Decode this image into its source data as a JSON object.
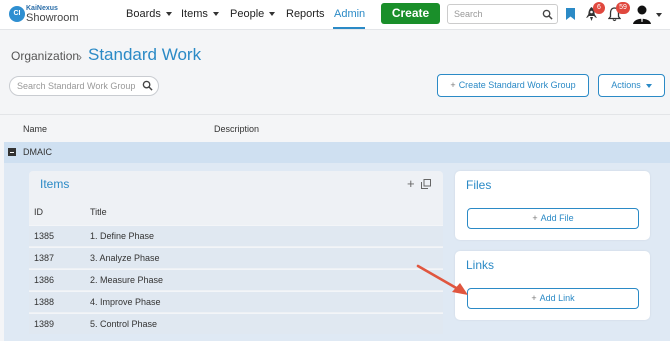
{
  "topnav": {
    "logo_top": "KaiNexus",
    "logo_bottom": "Showroom",
    "logo_badge": "CI",
    "menu": [
      {
        "label": "Boards",
        "has_dropdown": true
      },
      {
        "label": "Items",
        "has_dropdown": true
      },
      {
        "label": "People",
        "has_dropdown": true
      },
      {
        "label": "Reports",
        "has_dropdown": false
      },
      {
        "label": "Admin",
        "has_dropdown": false,
        "active": true
      }
    ],
    "create_label": "Create",
    "search_placeholder": "Search",
    "rocket_badge": "6",
    "bell_badge": "59",
    "accent_color": "#2b8ac6",
    "create_color": "#1a8f2a"
  },
  "breadcrumb": {
    "parent": "Organization",
    "current": "Standard Work"
  },
  "toolbar": {
    "search_placeholder": "Search Standard Work Groups...",
    "create_group_label": "Create Standard Work Group",
    "actions_label": "Actions"
  },
  "table": {
    "headers": {
      "name": "Name",
      "description": "Description"
    },
    "group": {
      "name": "DMAIC",
      "items": {
        "title": "Items",
        "columns": {
          "id": "ID",
          "title": "Title"
        },
        "rows": [
          {
            "id": "1385",
            "title": "1. Define Phase"
          },
          {
            "id": "1387",
            "title": "3. Analyze Phase"
          },
          {
            "id": "1386",
            "title": "2. Measure Phase"
          },
          {
            "id": "1388",
            "title": "4. Improve Phase"
          },
          {
            "id": "1389",
            "title": "5. Control Phase"
          }
        ]
      },
      "files": {
        "title": "Files",
        "button": "Add File"
      },
      "links": {
        "title": "Links",
        "button": "Add Link"
      }
    }
  },
  "icons": [
    "search-icon",
    "bookmark-icon",
    "rocket-icon",
    "bell-icon",
    "avatar-icon",
    "plus-icon",
    "popout-icon",
    "collapse-icon",
    "arrow-annotation-icon"
  ]
}
